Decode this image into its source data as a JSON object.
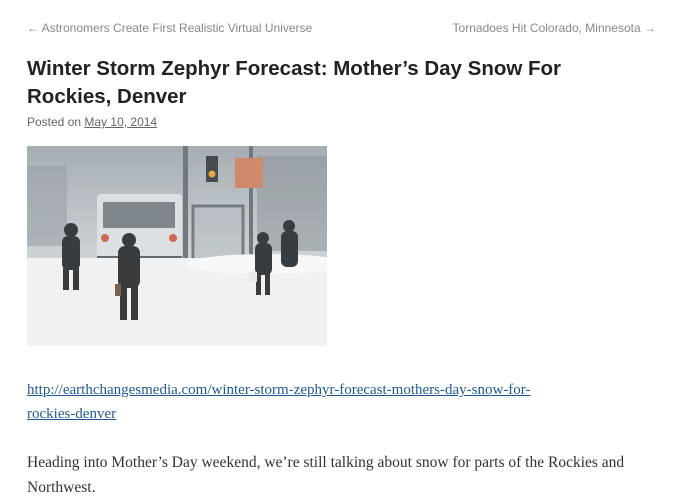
{
  "nav": {
    "prev_arrow": "←",
    "prev_label": "Astronomers Create First Realistic Virtual Universe",
    "next_label": "Tornadoes Hit Colorado, Minnesota",
    "next_arrow": "→"
  },
  "post": {
    "title": "Winter Storm Zephyr Forecast: Mother’s Day Snow For Rockies, Denver",
    "posted_on_label": "Posted on",
    "date": "May 10, 2014",
    "link_line1": "http://earthchangesmedia.com/winter-storm-zephyr-forecast-mothers-day-snow-for-",
    "link_line2": "rockies-denver",
    "paragraph": "Heading into Mother’s Day weekend, we’re still talking about snow for parts of the Rockies and Northwest."
  },
  "image": {
    "icons": [
      "street-scene-photo"
    ]
  }
}
